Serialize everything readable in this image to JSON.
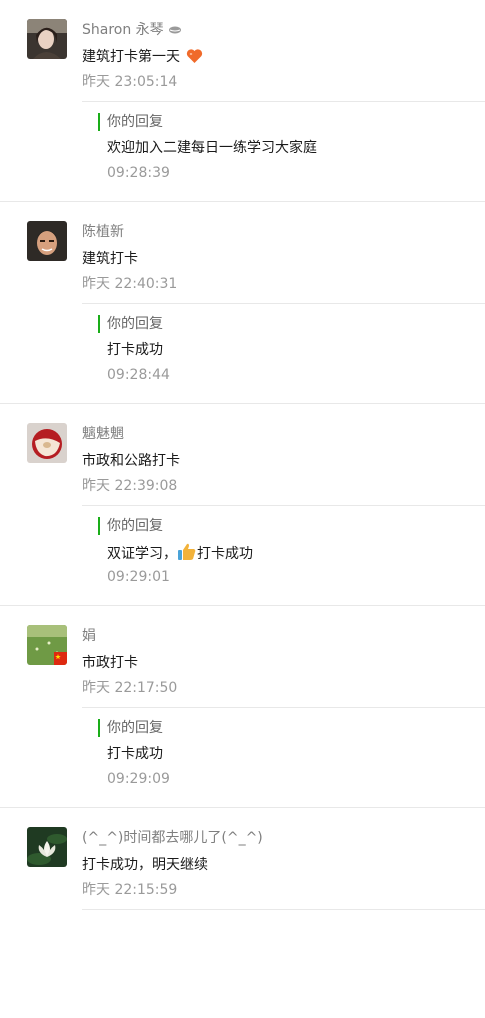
{
  "messages": [
    {
      "avatar_icon": "user-photo-avatar",
      "name": "Sharon 永琴",
      "text": "建筑打卡第一天",
      "time": "昨天 23:05:14",
      "reply_label": "你的回复",
      "reply_text": "欢迎加入二建每日一练学习大家庭",
      "reply_time": "09:28:39"
    },
    {
      "avatar_icon": "user-photo-avatar",
      "name": "陈植新",
      "text": "建筑打卡",
      "time": "昨天 22:40:31",
      "reply_label": "你的回复",
      "reply_text": "打卡成功",
      "reply_time": "09:28:44"
    },
    {
      "avatar_icon": "apple-avatar",
      "name": "魑魅魍",
      "text": "市政和公路打卡",
      "time": "昨天 22:39:08",
      "reply_label": "你的回复",
      "reply_text_before": "双证学习，",
      "reply_text_after": "打卡成功",
      "reply_time": "09:29:01"
    },
    {
      "avatar_icon": "grass-flag-avatar",
      "name": "娟",
      "text": "市政打卡",
      "time": "昨天 22:17:50",
      "reply_label": "你的回复",
      "reply_text": "打卡成功",
      "reply_time": "09:29:09"
    },
    {
      "avatar_icon": "lotus-avatar",
      "name": "(^_^)时间都去哪儿了(^_^)",
      "text": "打卡成功，明天继续",
      "time": "昨天 22:15:59"
    }
  ],
  "colors": {
    "reply_bar": "#1aad19",
    "secondary_text": "#9a9a9a",
    "divider": "#e8e8e8"
  }
}
